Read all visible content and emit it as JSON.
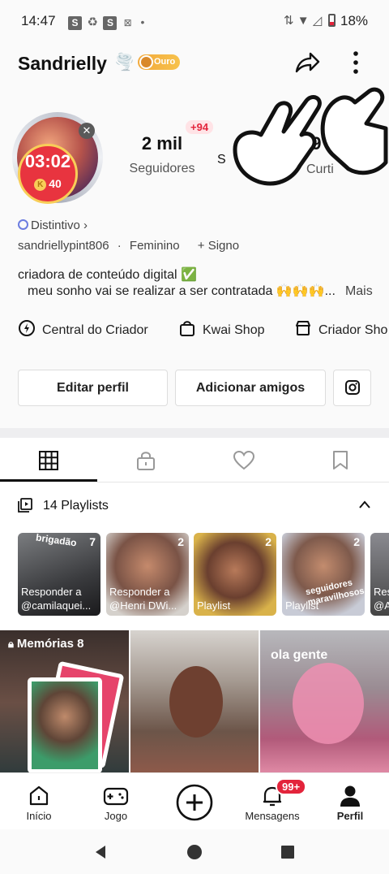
{
  "status": {
    "time": "14:47",
    "battery": "18%"
  },
  "header": {
    "username": "Sandrielly",
    "emoji": "🌪️",
    "tier_badge": "Ouro"
  },
  "profile": {
    "timer": "03:02",
    "coins": "40",
    "followers_count": "2 mil",
    "followers_label": "Seguidores",
    "new_followers": "+94",
    "following_count": "19 mi",
    "following_label_partial": "S",
    "likes_label_partial": "Curti",
    "distintivo": "Distintivo",
    "handle": "sandriellypint806",
    "gender": "Feminino",
    "sign": "+ Signo",
    "bio_line1": "criadora de conteúdo digital ✅",
    "bio_line2": "meu sonho vai se realizar a ser  contratada 🙌🙌🙌...",
    "bio_more": "Mais"
  },
  "tools": {
    "creator_center": "Central do Criador",
    "kwai_shop": "Kwai Shop",
    "creator_shop": "Criador Sho"
  },
  "actions": {
    "edit_profile": "Editar perfil",
    "add_friends": "Adicionar amigos"
  },
  "playlists": {
    "header": "14 Playlists",
    "items": [
      {
        "count": "7",
        "text1": "Responder a",
        "text2": "@camilaquei...",
        "overlay": "brigadão"
      },
      {
        "count": "2",
        "text1": "Responder a",
        "text2": "@Henri DWi..."
      },
      {
        "count": "2",
        "text1": "Playlist",
        "text2": ""
      },
      {
        "count": "2",
        "text1": "Playlist",
        "text2": "",
        "overlay": "seguidores maravilhosos"
      },
      {
        "count": "",
        "text1": "Res",
        "text2": "@A"
      }
    ]
  },
  "grid": {
    "memories_label": "Memórias 8",
    "caption3": "ola gente"
  },
  "nav": {
    "home": "Início",
    "games": "Jogo",
    "messages": "Mensagens",
    "messages_badge": "99+",
    "profile": "Perfil"
  },
  "colors": {
    "accent_red": "#e3243b",
    "gold": "#f2a93b"
  }
}
